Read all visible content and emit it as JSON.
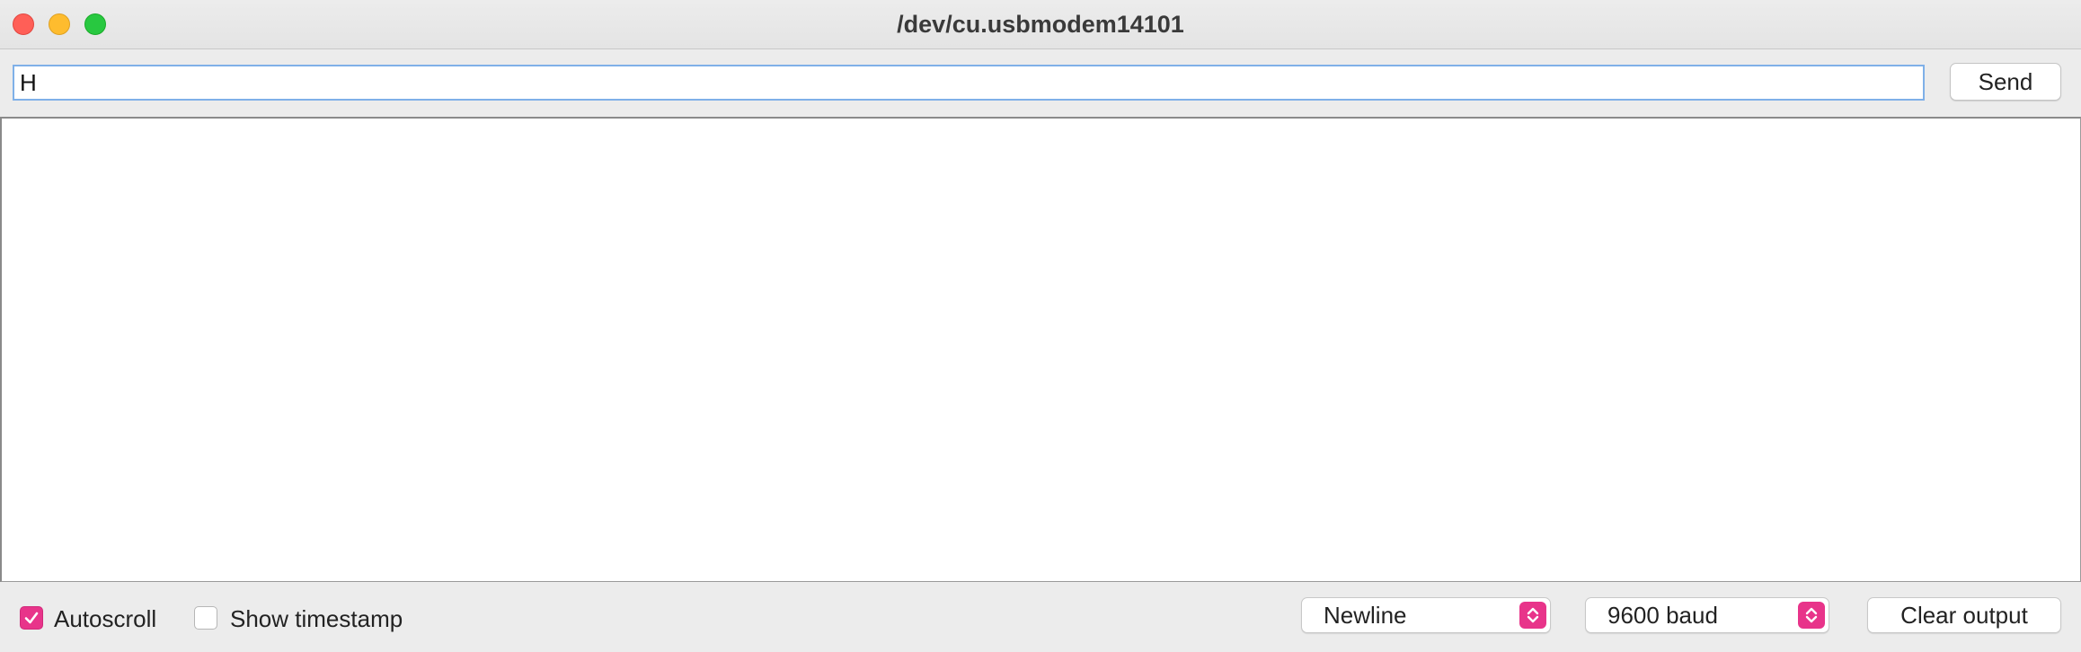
{
  "window": {
    "title": "/dev/cu.usbmodem14101"
  },
  "send_row": {
    "input_value": "H",
    "send_label": "Send"
  },
  "output": {
    "text": ""
  },
  "bottom_bar": {
    "autoscroll": {
      "label": "Autoscroll",
      "checked": true
    },
    "show_timestamp": {
      "label": "Show timestamp",
      "checked": false
    },
    "line_ending": {
      "selected": "Newline"
    },
    "baud_rate": {
      "selected": "9600 baud"
    },
    "clear_label": "Clear output"
  },
  "colors": {
    "accent": "#e8348a",
    "input_focus": "#7fb0e8",
    "close": "#ff5f57",
    "minimize": "#febc2e",
    "maximize": "#28c840"
  },
  "icons": {
    "autoscroll_check": "checkmark-icon",
    "select_arrows": "chevron-up-down-icon"
  }
}
